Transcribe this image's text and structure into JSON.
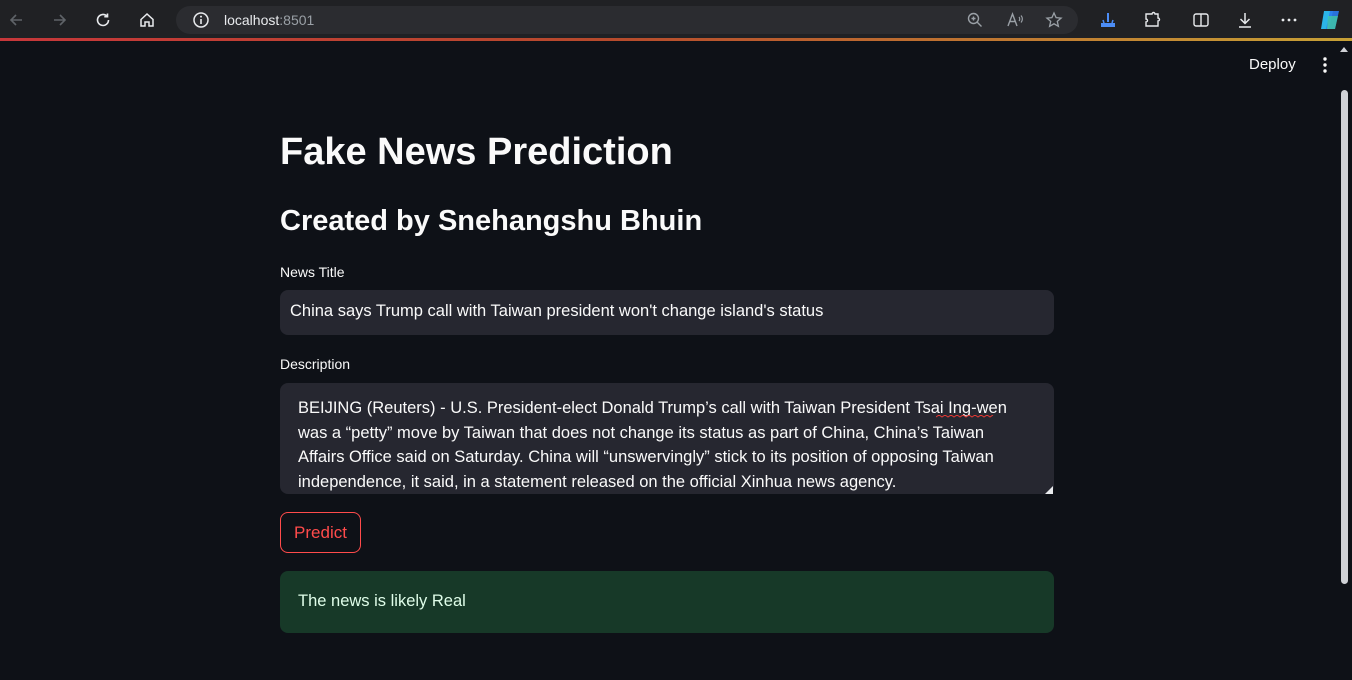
{
  "browser": {
    "url_host": "localhost",
    "url_port": ":8501"
  },
  "header": {
    "deploy_label": "Deploy"
  },
  "app": {
    "title": "Fake News Prediction",
    "subtitle": "Created by Snehangshu Bhuin",
    "news_title": {
      "label": "News Title",
      "value": "China says Trump call with Taiwan president won't change island's status"
    },
    "description": {
      "label": "Description",
      "value": "BEIJING (Reuters) - U.S. President-elect Donald Trump’s call with Taiwan President Tsai Ing-wen was a “petty” move by Taiwan that does not change its status as part of China, China’s Taiwan Affairs Office said on Saturday. China will “unswervingly” stick to its position of opposing Taiwan independence, it said, in a statement released on the official Xinhua news agency."
    },
    "predict_label": "Predict",
    "result_text": "The news is likely Real"
  },
  "colors": {
    "background": "#0e1117",
    "input_bg": "#262730",
    "accent": "#ff4b4b",
    "success_bg": "#173928",
    "success_text": "#dffde9"
  },
  "icons": [
    "back-icon",
    "forward-icon",
    "reload-icon",
    "home-icon",
    "info-icon",
    "zoom-icon",
    "read-aloud-icon",
    "favorite-star-icon",
    "browser-essentials-icon",
    "extensions-icon",
    "split-screen-icon",
    "downloads-icon",
    "more-icon",
    "copilot-icon",
    "kebab-menu-icon"
  ]
}
